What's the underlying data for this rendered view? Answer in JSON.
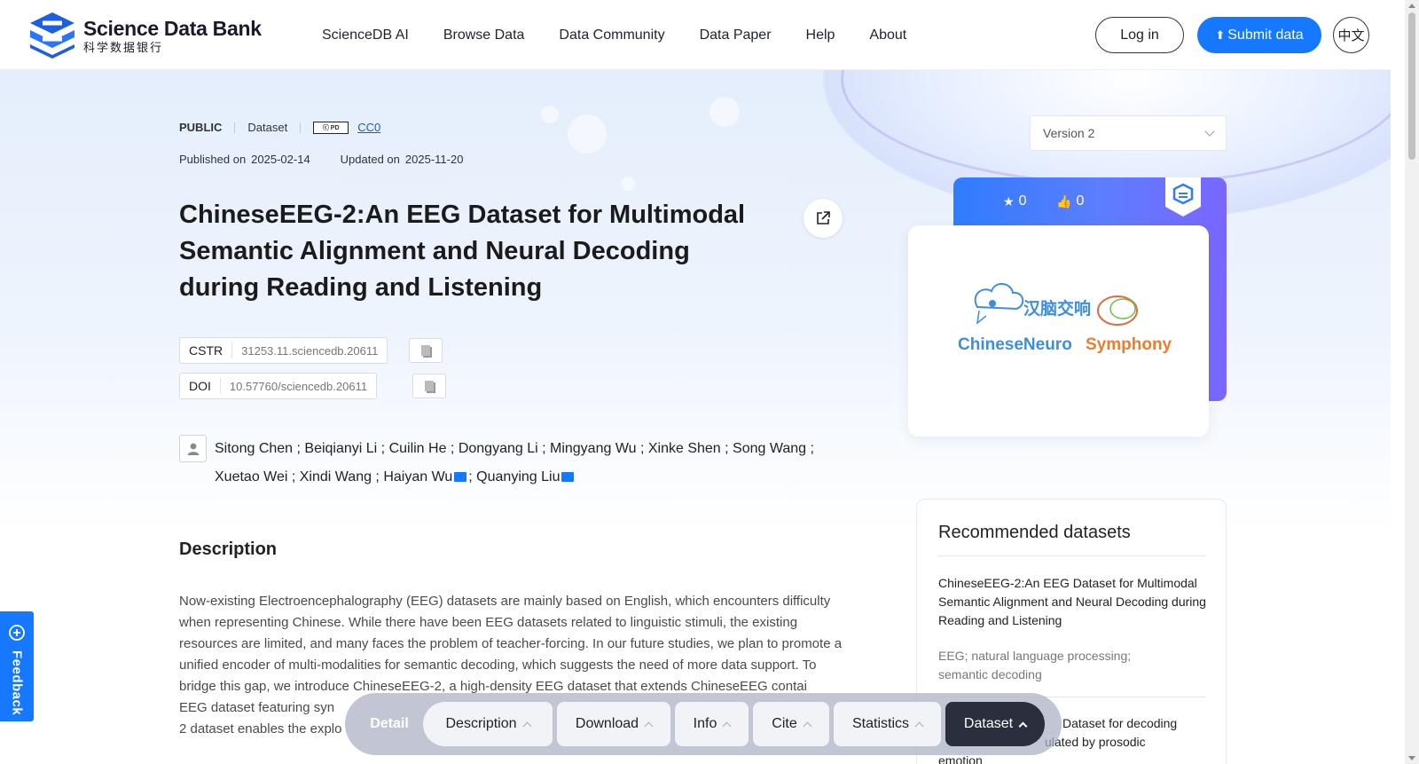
{
  "brand": {
    "name_en": "Science Data Bank",
    "name_cn": "科学数据银行"
  },
  "nav": [
    "ScienceDB AI",
    "Browse Data",
    "Data Community",
    "Data Paper",
    "Help",
    "About"
  ],
  "header_actions": {
    "login": "Log in",
    "submit": "Submit data",
    "lang": "中文"
  },
  "meta": {
    "visibility": "PUBLIC",
    "type": "Dataset",
    "license": "CC0",
    "published_label": "Published on",
    "published": "2025-02-14",
    "updated_label": "Updated on",
    "updated": "2025-11-20"
  },
  "title": "ChineseEEG-2:An EEG Dataset for Multimodal Semantic Alignment and Neural Decoding during Reading and Listening",
  "ids": {
    "cstr_label": "CSTR",
    "cstr": "31253.11.sciencedb.20611",
    "doi_label": "DOI",
    "doi": "10.57760/sciencedb.20611"
  },
  "authors": {
    "line1": "Sitong Chen ; Beiqianyi Li ; Cuilin He ; Dongyang Li ; Mingyang Wu ; Xinke Shen ; Song Wang ;",
    "line2a": "Xuetao Wei ; Xindi Wang ; Haiyan Wu",
    "line2b": "; Quanying Liu"
  },
  "description": {
    "heading": "Description",
    "text": "Now-existing Electroencephalography (EEG) datasets are mainly based on English, which encounters difficulty when representing Chinese. While there have been EEG datasets related to linguistic stimuli, the existing resources are limited, and many faces the problem of teacher-forcing. In our future studies, we plan to promote a unified encoder of multi-modalities for semantic decoding, which suggests the need of more data support. To bridge this gap, we introduce ChineseEEG-2, a high-density EEG dataset that extends ChineseEEG contai",
    "line7": "EEG dataset featuring syn",
    "line8": "2 dataset enables the explo"
  },
  "version": "Version 2",
  "stats": {
    "stars": "0",
    "likes": "0"
  },
  "cover": {
    "logo_cn": "汉脑交响",
    "logo_en1": "ChineseNeuro",
    "logo_en2": "Symphony"
  },
  "recommended": {
    "heading": "Recommended datasets",
    "items": [
      {
        "title": "ChineseEEG-2:An EEG Dataset for Multimodal Semantic Alignment and Neural Decoding during Reading and Listening",
        "keywords": "EEG; natural language processing; semantic decoding"
      },
      {
        "title_visible": "Dataset for decoding",
        "title_visible2": "ulated by prosodic",
        "title_visible3": "emotion"
      }
    ]
  },
  "feedback": "Feedback",
  "tabbar": {
    "detail": "Detail",
    "tabs": [
      "Description",
      "Download",
      "Info",
      "Cite",
      "Statistics",
      "Dataset"
    ]
  },
  "colors": {
    "primary": "#1677ff",
    "active_tab": "#2a2f3d"
  }
}
